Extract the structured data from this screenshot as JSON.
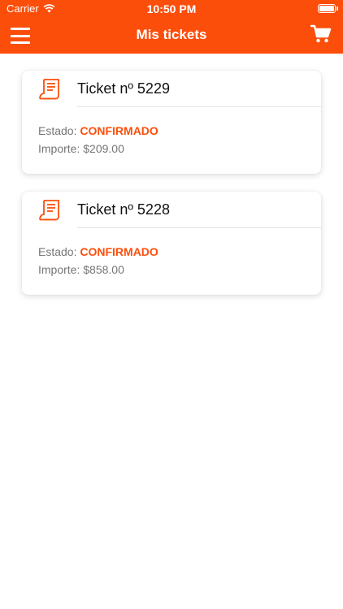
{
  "status_bar": {
    "carrier": "Carrier",
    "time": "10:50 PM"
  },
  "header": {
    "title": "Mis tickets"
  },
  "icons": {
    "menu": "hamburger-menu-icon",
    "cart": "shopping-cart-icon",
    "ticket": "receipt-icon",
    "wifi": "wifi-icon",
    "battery": "battery-icon"
  },
  "colors": {
    "accent": "#fc4e0b",
    "text": "#111111",
    "muted": "#757575"
  },
  "tickets": [
    {
      "title": "Ticket nº 5229",
      "estado_label": "Estado:",
      "estado_value": "CONFIRMADO",
      "importe_label": "Importe:",
      "importe_value": "$209.00"
    },
    {
      "title": "Ticket nº 5228",
      "estado_label": "Estado:",
      "estado_value": "CONFIRMADO",
      "importe_label": "Importe:",
      "importe_value": "$858.00"
    }
  ]
}
